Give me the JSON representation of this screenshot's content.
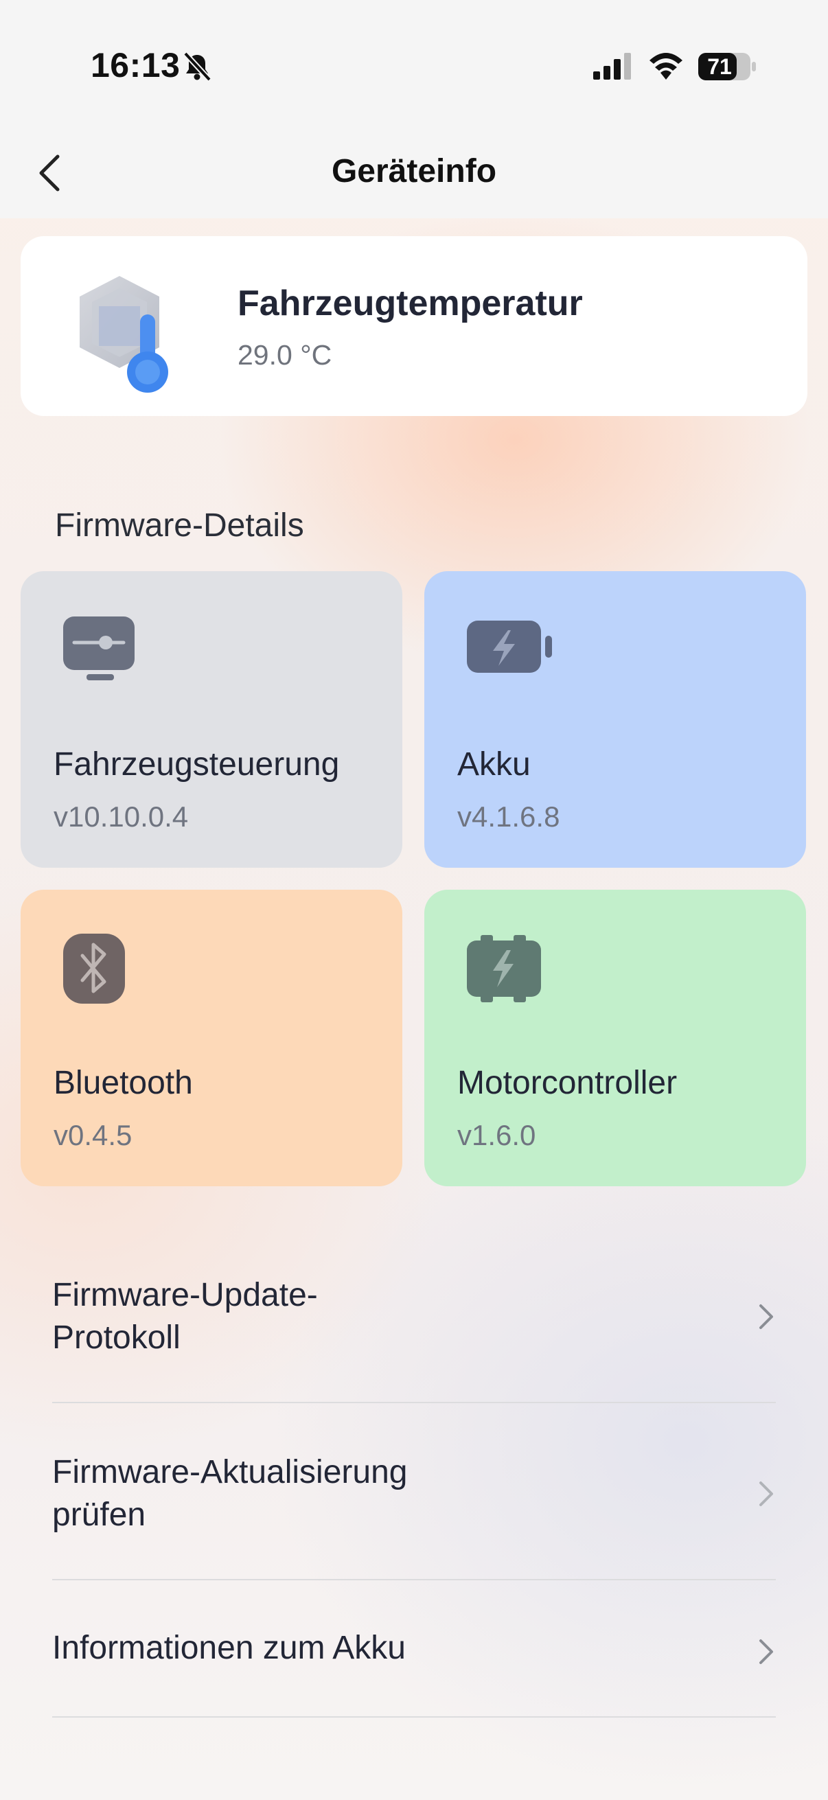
{
  "status_bar": {
    "time": "16:13",
    "battery": "71",
    "icons": [
      "bell-slash-icon",
      "cellular-signal-icon",
      "wifi-icon",
      "battery-icon"
    ]
  },
  "header": {
    "back_icon": "chevron-left-icon",
    "title": "Geräteinfo"
  },
  "device": {
    "name": "Fahrzeugtemperatur",
    "temperature": "29.0 °C",
    "icon": "thermometer-icon"
  },
  "firmware": {
    "section_title": "Firmware-Details",
    "tiles": [
      {
        "name": "Fahrzeugsteuerung",
        "version": "v10.10.0.4",
        "icon": "controller-icon",
        "color": "#e0e1e5"
      },
      {
        "name": "Akku",
        "version": "v4.1.6.8",
        "icon": "battery-icon",
        "color": "#bcd3fb"
      },
      {
        "name": "Bluetooth",
        "version": "v0.4.5",
        "icon": "bluetooth-icon",
        "color": "#fdd9b8"
      },
      {
        "name": "Motorcontroller",
        "version": "v1.6.0",
        "icon": "motor-icon",
        "color": "#c2efcb"
      }
    ]
  },
  "menu": {
    "items": [
      {
        "line1": "Firmware-Update-",
        "line2": "Protokoll"
      },
      {
        "line1": "Firmware-Aktualisierung",
        "line2": "prüfen"
      },
      {
        "line1": "Informationen zum Akku",
        "line2": ""
      }
    ]
  }
}
